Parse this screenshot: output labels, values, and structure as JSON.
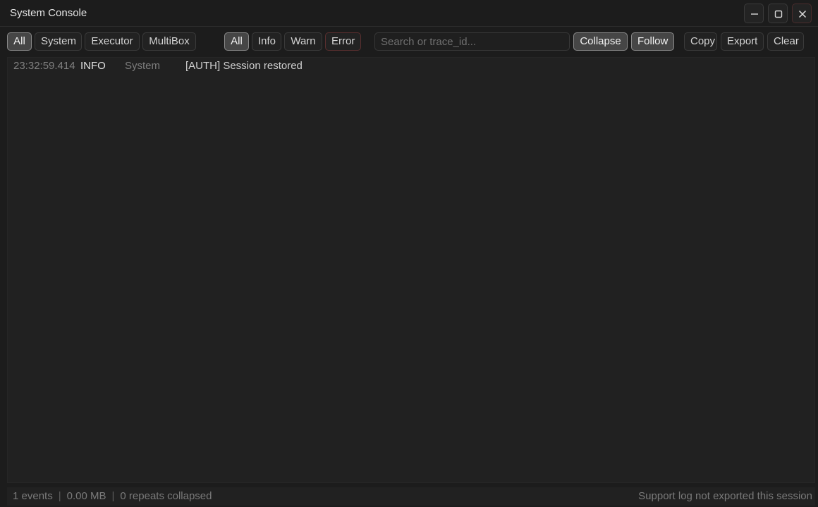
{
  "window": {
    "title": "System Console"
  },
  "source_filters": [
    {
      "label": "All",
      "active": true
    },
    {
      "label": "System",
      "active": false
    },
    {
      "label": "Executor",
      "active": false
    },
    {
      "label": "MultiBox",
      "active": false
    }
  ],
  "level_filters": [
    {
      "label": "All",
      "active": true
    },
    {
      "label": "Info",
      "active": false
    },
    {
      "label": "Warn",
      "active": false
    },
    {
      "label": "Error",
      "active": false
    }
  ],
  "search": {
    "placeholder": "Search or trace_id...",
    "value": ""
  },
  "view_toggles": {
    "collapse_label": "Collapse",
    "collapse_active": true,
    "follow_label": "Follow",
    "follow_active": true
  },
  "actions": {
    "copy_label": "Copy",
    "export_label": "Export",
    "clear_label": "Clear"
  },
  "logs": [
    {
      "time": "23:32:59.414",
      "level": "INFO",
      "source": "System",
      "message": "[AUTH] Session restored"
    }
  ],
  "status": {
    "events": "1 events",
    "size": "0.00 MB",
    "repeats": "0 repeats collapsed",
    "support_log": "Support log not exported this session"
  },
  "icons": {
    "minimize": "minimize-icon",
    "maximize": "maximize-icon",
    "close": "close-icon"
  }
}
